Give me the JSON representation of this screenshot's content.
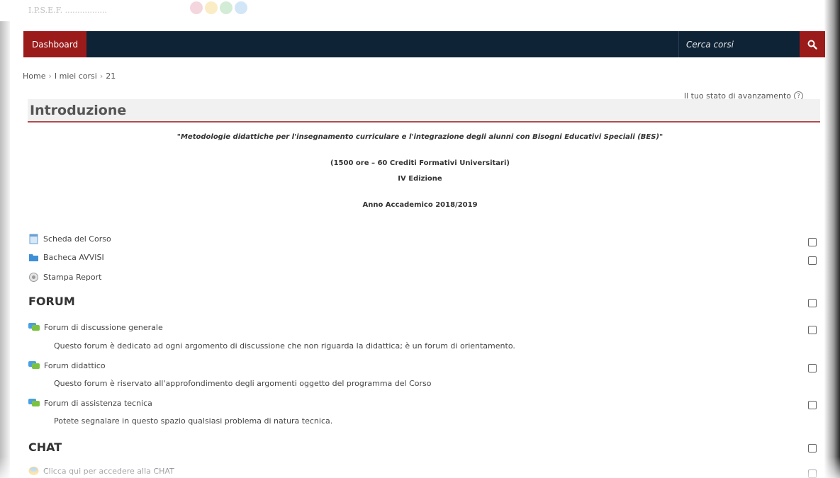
{
  "brand": {
    "text": "I.P.S.E.F. .................",
    "dot_colors": [
      "#e8a6b8",
      "#f5d680",
      "#9fd6a5",
      "#9cc8ef"
    ]
  },
  "navbar": {
    "dashboard_label": "Dashboard",
    "search_placeholder": "Cerca corsi",
    "search_icon": "search-icon",
    "colors": {
      "bar": "#0f2336",
      "accent": "#9b1b1b"
    }
  },
  "breadcrumb": [
    "Home",
    "I miei corsi",
    "21"
  ],
  "progress_note": "Il tuo stato di avanzamento",
  "section_title": "Introduzione",
  "intro": {
    "quote": "\"Metodologie didattiche per l'insegnamento curriculare e l'integrazione degli alunni con Bisogni Educativi Speciali (BES)\"",
    "hours": "(1500 ore – 60 Crediti Formativi Universitari)",
    "edition": "IV Edizione",
    "year": "Anno Accademico 2018/2019"
  },
  "top_activities": [
    {
      "label": "Scheda del Corso",
      "icon": "document-icon"
    },
    {
      "label": "Bacheca AVVISI",
      "icon": "folder-icon"
    },
    {
      "label": "Stampa Report",
      "icon": "report-icon"
    }
  ],
  "forum": {
    "heading": "FORUM",
    "items": [
      {
        "label": "Forum di discussione generale",
        "desc": "Questo forum è dedicato ad ogni argomento di discussione che non riguarda la didattica; è un forum di orientamento."
      },
      {
        "label": "Forum didattico",
        "desc": "Questo forum è riservato all'approfondimento degli argomenti oggetto del programma del Corso"
      },
      {
        "label": "Forum di assistenza tecnica",
        "desc": "Potete segnalare in questo spazio qualsiasi problema di natura tecnica."
      }
    ]
  },
  "chat": {
    "heading": "CHAT",
    "items": [
      {
        "label": "Clicca qui per accedere alla CHAT"
      }
    ]
  }
}
